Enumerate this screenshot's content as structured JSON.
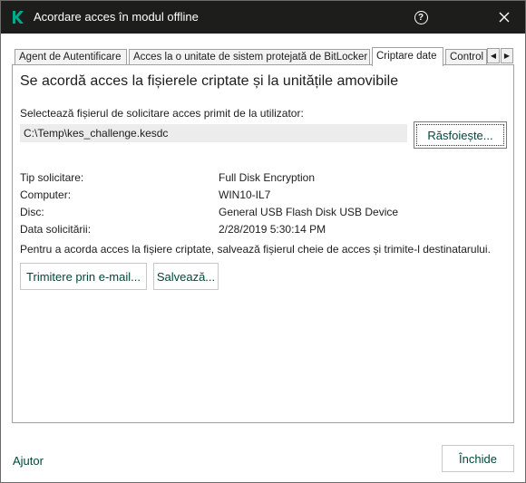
{
  "window": {
    "title": "Acordare acces în modul offline",
    "help_label": "?",
    "close_label": "✕"
  },
  "tabs": [
    {
      "label": "Agent de Autentificare"
    },
    {
      "label": "Acces la o unitate de sistem protejată de BitLocker"
    },
    {
      "label": "Criptare date"
    },
    {
      "label": "Control"
    }
  ],
  "tab_scroll": {
    "left": "◀",
    "right": "▶"
  },
  "panel": {
    "heading": "Se acordă acces la fișierele criptate și la unitățile amovibile",
    "file_label": "Selectează fișierul de solicitare acces primit de la utilizator:",
    "file_value": "C:\\Temp\\kes_challenge.kesdc",
    "browse_label": "Răsfoiește...",
    "details": [
      {
        "key": "Tip solicitare:",
        "value": "Full Disk Encryption"
      },
      {
        "key": "Computer:",
        "value": "WIN10-IL7"
      },
      {
        "key": "Disc:",
        "value": "General USB Flash Disk USB Device"
      },
      {
        "key": "Data solicitării:",
        "value": "2/28/2019 5:30:14 PM"
      }
    ],
    "instruction": "Pentru a acorda acces la fișiere criptate, salvează fișierul cheie de acces și trimite-l destinatarului.",
    "email_label": "Trimitere prin e-mail...",
    "save_label": "Salvează..."
  },
  "footer": {
    "help_link": "Ajutor",
    "close_label": "Închide"
  },
  "colors": {
    "titlebar": "#1d1d1b",
    "accent": "#00a88e",
    "link": "#00483a"
  },
  "icons": {
    "logo": "kaspersky-logo-icon",
    "help": "help-icon",
    "close": "close-icon"
  }
}
